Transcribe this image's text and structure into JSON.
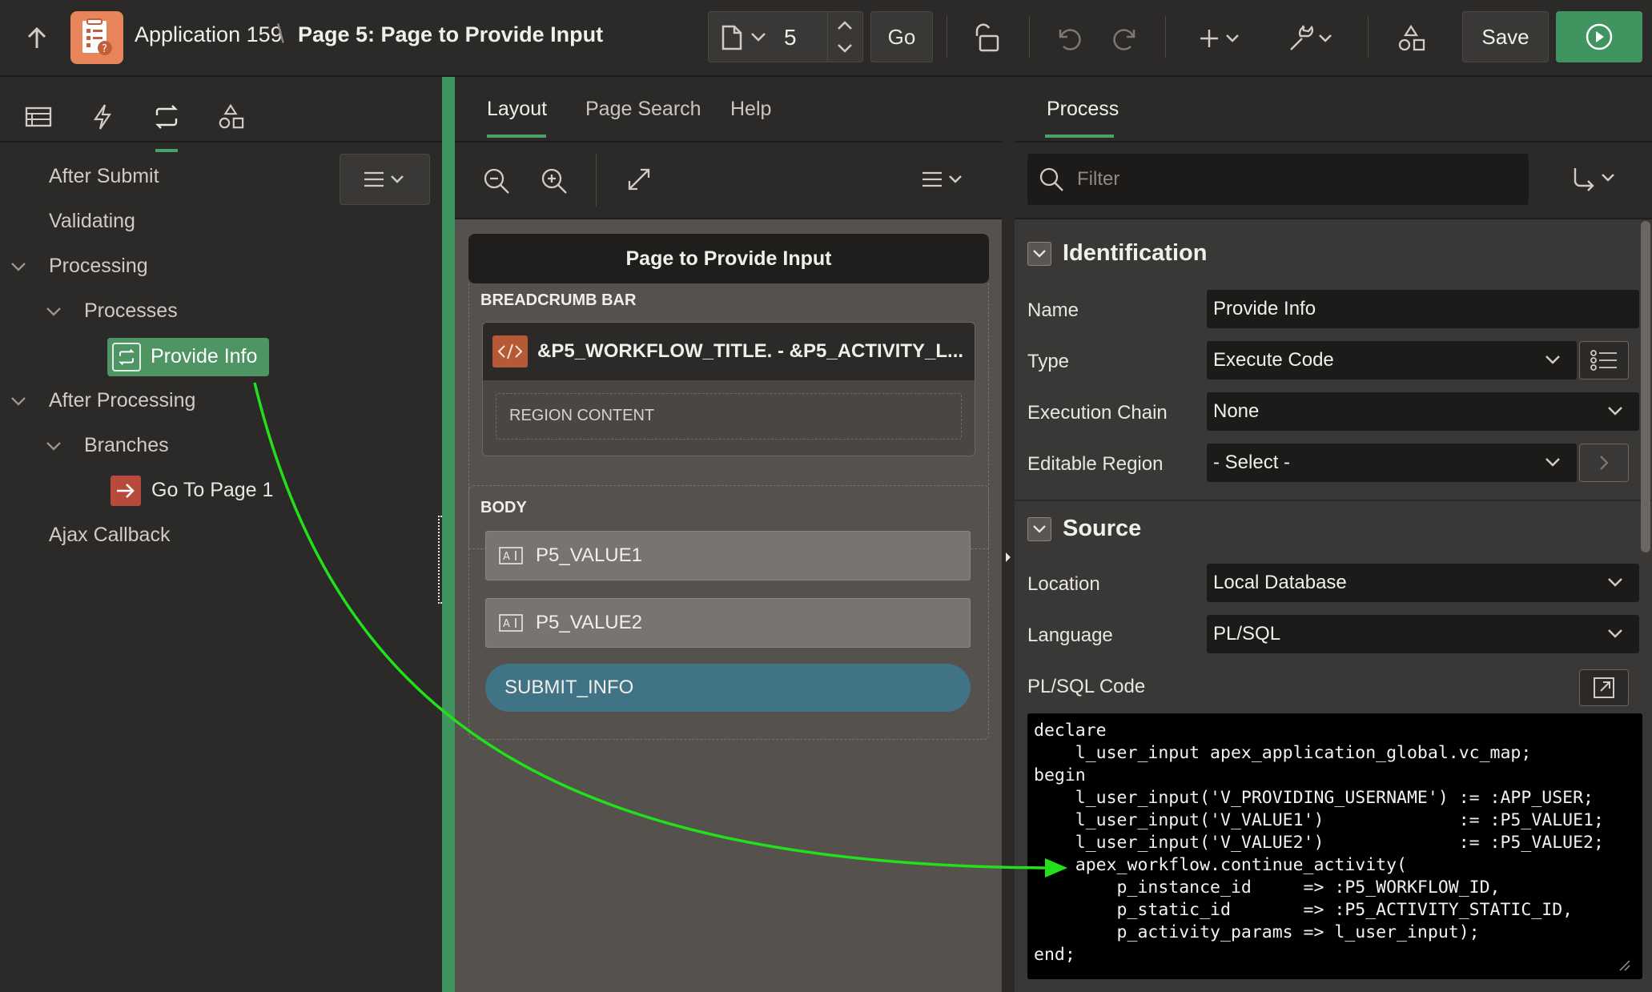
{
  "header": {
    "app_name": "Application 159",
    "crumb_separator": "\\",
    "page_name": "Page 5: Page to Provide Input",
    "page_number": "5",
    "go_label": "Go",
    "save_label": "Save"
  },
  "left": {
    "tree": {
      "after_submit": "After Submit",
      "validating": "Validating",
      "processing": "Processing",
      "processes": "Processes",
      "provide_info": "Provide Info",
      "after_processing": "After Processing",
      "branches": "Branches",
      "go_to_page": "Go To Page 1",
      "ajax_callback": "Ajax Callback"
    }
  },
  "center": {
    "tabs": [
      "Layout",
      "Page Search",
      "Help"
    ],
    "page_title": "Page to Provide Input",
    "breadcrumb_bar": "BREADCRUMB BAR",
    "breadcrumb_item": "&P5_WORKFLOW_TITLE. - &P5_ACTIVITY_L...",
    "region_content": "REGION CONTENT",
    "body": "BODY",
    "items": [
      "P5_VALUE1",
      "P5_VALUE2"
    ],
    "button_label": "SUBMIT_INFO"
  },
  "right": {
    "tab": "Process",
    "filter_placeholder": "Filter",
    "identification": {
      "title": "Identification",
      "name_label": "Name",
      "name_value": "Provide Info",
      "type_label": "Type",
      "type_value": "Execute Code",
      "exec_chain_label": "Execution Chain",
      "exec_chain_value": "None",
      "editable_region_label": "Editable Region",
      "editable_region_value": "- Select -"
    },
    "source": {
      "title": "Source",
      "location_label": "Location",
      "location_value": "Local Database",
      "language_label": "Language",
      "language_value": "PL/SQL",
      "code_label": "PL/SQL Code",
      "code": "declare\n    l_user_input apex_application_global.vc_map;\nbegin\n    l_user_input('V_PROVIDING_USERNAME') := :APP_USER;\n    l_user_input('V_VALUE1')             := :P5_VALUE1;\n    l_user_input('V_VALUE2')             := :P5_VALUE2;\n    apex_workflow.continue_activity(\n        p_instance_id     => :P5_WORKFLOW_ID,\n        p_static_id       => :P5_ACTIVITY_STATIC_ID,\n        p_activity_params => l_user_input);\nend;"
    }
  },
  "colors": {
    "accent_green": "#3f9460",
    "annotation_arrow": "#22e01a",
    "button_teal": "#3f7385",
    "logo_orange": "#e8855a"
  }
}
